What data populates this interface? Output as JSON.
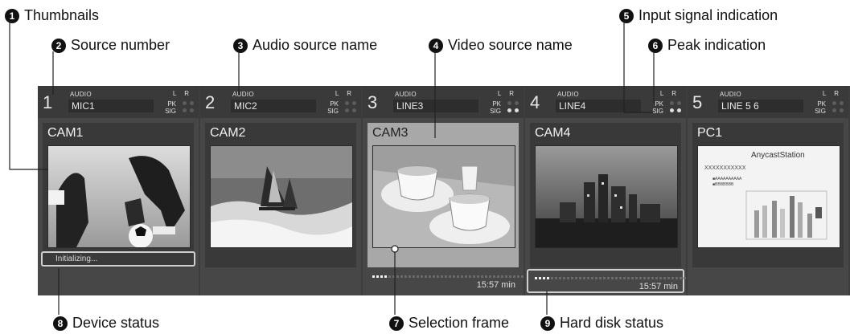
{
  "callouts": [
    {
      "num": "1",
      "text": "Thumbnails"
    },
    {
      "num": "2",
      "text": "Source number"
    },
    {
      "num": "3",
      "text": "Audio source name"
    },
    {
      "num": "4",
      "text": "Video source name"
    },
    {
      "num": "5",
      "text": "Input signal indication"
    },
    {
      "num": "6",
      "text": "Peak indication"
    },
    {
      "num": "7",
      "text": "Selection frame"
    },
    {
      "num": "8",
      "text": "Device status"
    },
    {
      "num": "9",
      "text": "Hard disk status"
    }
  ],
  "labels": {
    "audio": "AUDIO",
    "lr": "L R",
    "pk": "PK",
    "sig": "SIG"
  },
  "sources": [
    {
      "number": "1",
      "audio_name": "MIC1",
      "video_name": "CAM1",
      "thumbnail": "soccer-icon",
      "status": "Initializing...",
      "pk": [
        false,
        false
      ],
      "sig": [
        false,
        false
      ]
    },
    {
      "number": "2",
      "audio_name": "MIC2",
      "video_name": "CAM2",
      "thumbnail": "windsurf-icon",
      "pk": [
        false,
        false
      ],
      "sig": [
        false,
        false
      ]
    },
    {
      "number": "3",
      "audio_name": "LINE3",
      "video_name": "CAM3",
      "thumbnail": "teacups-icon",
      "selected": true,
      "pk": [
        false,
        false
      ],
      "sig": [
        true,
        true
      ],
      "hdd_time": "15:57 min",
      "hdd_fill": 0.07
    },
    {
      "number": "4",
      "audio_name": "LINE4",
      "video_name": "CAM4",
      "thumbnail": "cityscape-icon",
      "pk": [
        false,
        false
      ],
      "sig": [
        true,
        true
      ],
      "hdd_time": "15:57 min",
      "hdd_fill": 0.07
    },
    {
      "number": "5",
      "audio_name": "LINE 5 6",
      "video_name": "PC1",
      "thumbnail": "presentation-icon",
      "pk": [
        false,
        false
      ],
      "sig": [
        false,
        false
      ],
      "slide": {
        "title": "AnycastStation",
        "line": "XXXXXXXXXXX",
        "bullet1": "AAAAAAAAAA",
        "bullet2": "BBBBBBB"
      }
    }
  ]
}
